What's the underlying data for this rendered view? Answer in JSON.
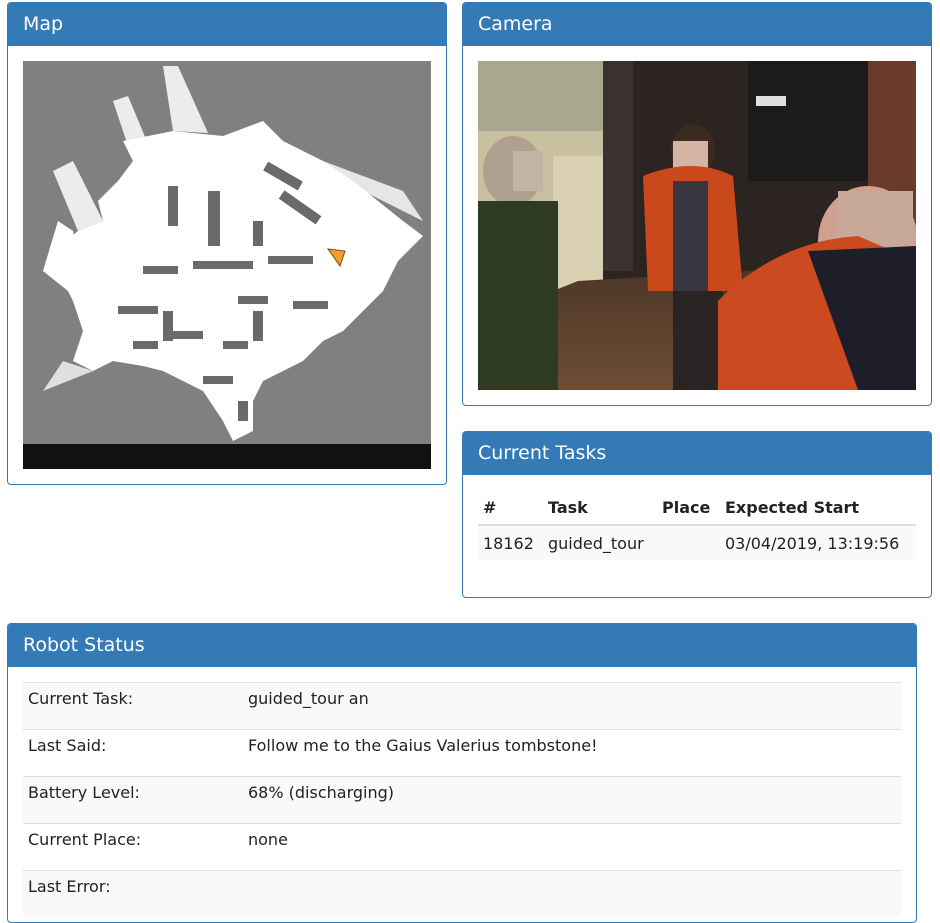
{
  "map_panel": {
    "title": "Map"
  },
  "camera_panel": {
    "title": "Camera"
  },
  "tasks_panel": {
    "title": "Current Tasks",
    "columns": [
      "#",
      "Task",
      "Place",
      "Expected Start"
    ],
    "rows": [
      {
        "id": "18162",
        "task": "guided_tour",
        "place": "",
        "expected_start": "03/04/2019, 13:19:56"
      }
    ]
  },
  "status_panel": {
    "title": "Robot Status",
    "rows": [
      {
        "label": "Current Task:",
        "value": "guided_tour an"
      },
      {
        "label": "Last Said:",
        "value": "Follow me to the Gaius Valerius tombstone!"
      },
      {
        "label": "Battery Level:",
        "value": "68% (discharging)"
      },
      {
        "label": "Current Place:",
        "value": "none"
      },
      {
        "label": "Last Error:",
        "value": ""
      }
    ]
  },
  "colors": {
    "panel_primary": "#337ab7",
    "map_unknown": "#808080",
    "map_free": "#ffffff",
    "robot_marker": "#f0a030"
  }
}
